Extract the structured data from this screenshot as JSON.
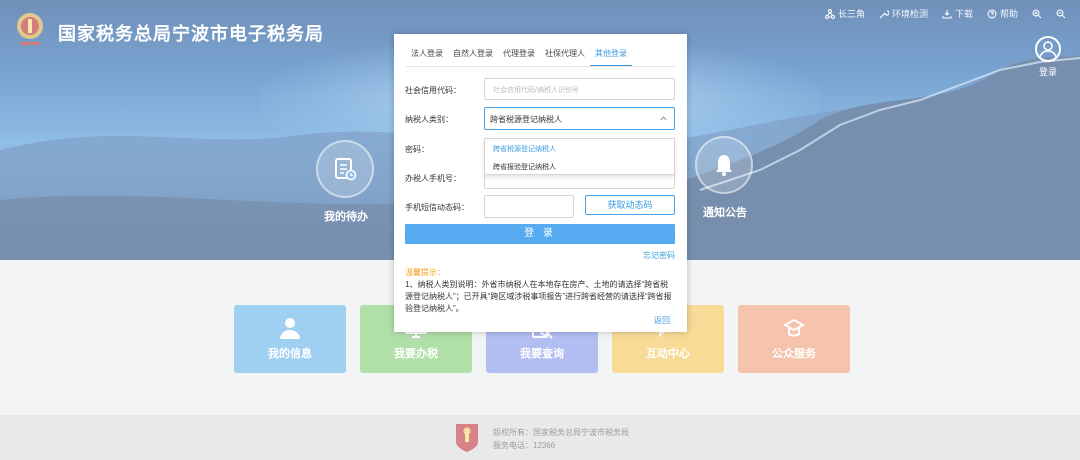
{
  "header": {
    "site_title": "国家税务总局宁波市电子税务局",
    "nav": [
      {
        "label": "长三角",
        "icon": "network-icon"
      },
      {
        "label": "环境检测",
        "icon": "tools-icon"
      },
      {
        "label": "下载",
        "icon": "download-icon"
      },
      {
        "label": "帮助",
        "icon": "help-icon"
      }
    ],
    "user_login_label": "登录"
  },
  "hero": {
    "todo_label": "我的待办",
    "notice_label": "通知公告"
  },
  "tiles": [
    {
      "label": "我的信息",
      "color": "#5aaee8",
      "icon": "user-icon"
    },
    {
      "label": "我要办税",
      "color": "#79c96a",
      "icon": "monitor-icon"
    },
    {
      "label": "我要查询",
      "color": "#7b8ee8",
      "icon": "search-doc-icon"
    },
    {
      "label": "互动中心",
      "color": "#f1c14a",
      "icon": "chat-icon"
    },
    {
      "label": "公众服务",
      "color": "#ef9a73",
      "icon": "service-icon"
    }
  ],
  "footer": {
    "copyright": "版权所有：国家税务总局宁波市税务局",
    "hotline": "服务电话：12366"
  },
  "login_modal": {
    "tabs": [
      "法人登录",
      "自然人登录",
      "代理登录",
      "社保代理人",
      "其他登录"
    ],
    "active_tab": 4,
    "credit_code_label": "社会信用代码：",
    "credit_code_placeholder": "社会信用代码/纳税人识别号",
    "taxpayer_type_label": "纳税人类别：",
    "taxpayer_type_value": "跨省税源登记纳税人",
    "taxpayer_type_options": [
      "跨省税源登记纳税人",
      "跨省报验登记纳税人"
    ],
    "password_label": "密码：",
    "phone_label": "办税人手机号：",
    "sms_label": "手机短信动态码：",
    "sms_button": "获取动态码",
    "login_button": "登 录",
    "forgot_password": "忘记密码",
    "tip_title": "温馨提示：",
    "tip_text": "1、纳税人类别说明：外省市纳税人在本地存在房产、土地的请选择“跨省税源登记纳税人”；已开具“跨区域涉税事项报告”进行跨省经营的请选择“跨省报验登记纳税人”。",
    "back_link": "返回"
  },
  "colors": {
    "accent": "#3a9be0",
    "login_button": "#55aaf0",
    "tip_title": "#f39c12"
  }
}
